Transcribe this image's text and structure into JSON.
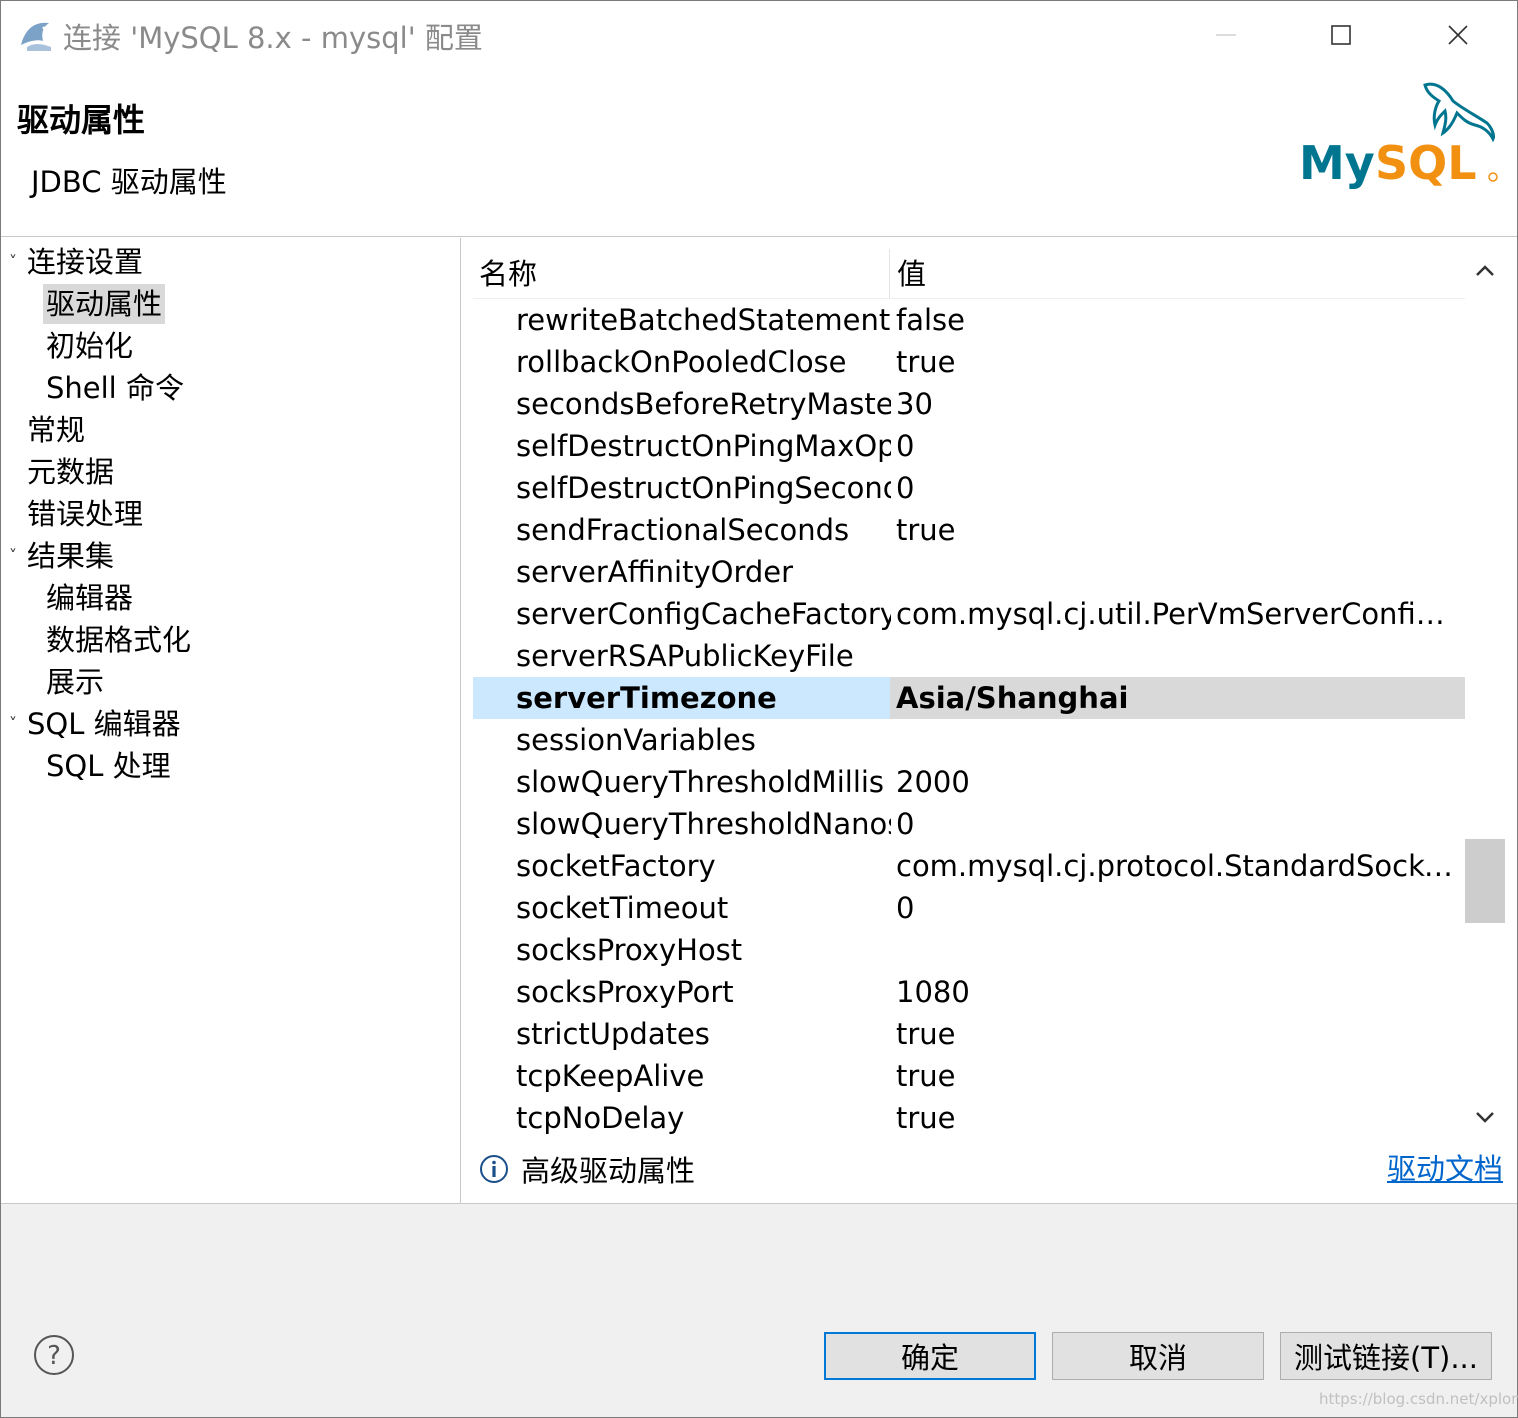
{
  "window": {
    "title": "连接 'MySQL 8.x - mysql' 配置",
    "minimize_icon": "minimize-icon",
    "maximize_icon": "maximize-icon",
    "close_icon": "close-icon"
  },
  "banner": {
    "title": "驱动属性",
    "subtitle": "JDBC 驱动属性",
    "logo_text": "MySQL",
    "logo_colors": {
      "my": "#00758f",
      "sql": "#f29111"
    }
  },
  "nav": {
    "items": [
      {
        "label": "连接设置",
        "expanded": true,
        "level": 0
      },
      {
        "label": "驱动属性",
        "selected": true,
        "level": 1
      },
      {
        "label": "初始化",
        "level": 1
      },
      {
        "label": "Shell 命令",
        "level": 1
      },
      {
        "label": "常规",
        "level": 0
      },
      {
        "label": "元数据",
        "level": 0
      },
      {
        "label": "错误处理",
        "level": 0
      },
      {
        "label": "结果集",
        "expanded": true,
        "level": 0
      },
      {
        "label": "编辑器",
        "level": 1
      },
      {
        "label": "数据格式化",
        "level": 1
      },
      {
        "label": "展示",
        "level": 1
      },
      {
        "label": "SQL 编辑器",
        "expanded": true,
        "level": 0
      },
      {
        "label": "SQL 处理",
        "level": 1
      }
    ]
  },
  "table": {
    "columns": [
      "名称",
      "值"
    ],
    "rows": [
      {
        "name": "rewriteBatchedStatements",
        "value": "false"
      },
      {
        "name": "rollbackOnPooledClose",
        "value": "true"
      },
      {
        "name": "secondsBeforeRetryMaster",
        "value": "30"
      },
      {
        "name": "selfDestructOnPingMaxOperations",
        "value": "0"
      },
      {
        "name": "selfDestructOnPingSecondsLifetime",
        "value": "0"
      },
      {
        "name": "sendFractionalSeconds",
        "value": "true"
      },
      {
        "name": "serverAffinityOrder",
        "value": ""
      },
      {
        "name": "serverConfigCacheFactory",
        "value": "com.mysql.cj.util.PerVmServerConfigC..."
      },
      {
        "name": "serverRSAPublicKeyFile",
        "value": ""
      },
      {
        "name": "serverTimezone",
        "value": "Asia/Shanghai",
        "selected": true
      },
      {
        "name": "sessionVariables",
        "value": ""
      },
      {
        "name": "slowQueryThresholdMillis",
        "value": "2000"
      },
      {
        "name": "slowQueryThresholdNanos",
        "value": "0"
      },
      {
        "name": "socketFactory",
        "value": "com.mysql.cj.protocol.StandardSocket..."
      },
      {
        "name": "socketTimeout",
        "value": "0"
      },
      {
        "name": "socksProxyHost",
        "value": ""
      },
      {
        "name": "socksProxyPort",
        "value": "1080"
      },
      {
        "name": "strictUpdates",
        "value": "true"
      },
      {
        "name": "tcpKeepAlive",
        "value": "true"
      },
      {
        "name": "tcpNoDelay",
        "value": "true"
      }
    ],
    "scroll_position": 0.72
  },
  "info": {
    "icon": "info-icon",
    "text": "高级驱动属性",
    "link": "驱动文档"
  },
  "footer": {
    "help_icon": "help-icon",
    "ok_label": "确定",
    "cancel_label": "取消",
    "test_label": "测试链接(T)...",
    "watermark": "https://blog.csdn.net/xplong"
  },
  "colors": {
    "selection_name_bg": "#cce8ff",
    "selection_value_bg": "#d9d9d9",
    "link": "#0066cc",
    "default_button_border": "#0078d7"
  }
}
